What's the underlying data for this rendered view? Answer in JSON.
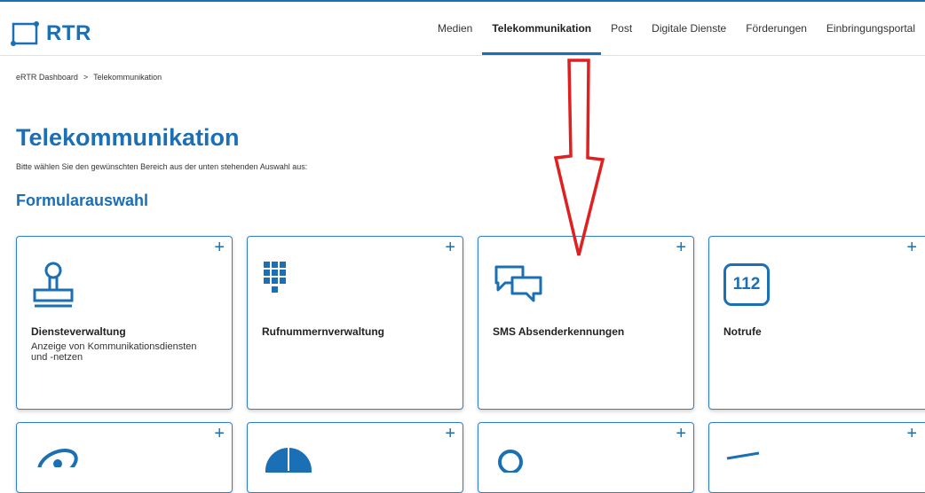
{
  "header": {
    "logo_text": "RTR",
    "nav": [
      "Medien",
      "Telekommunikation",
      "Post",
      "Digitale Dienste",
      "Förderungen",
      "Einbringungsportal"
    ],
    "active_nav": "Telekommunikation"
  },
  "breadcrumb": {
    "items": [
      "eRTR Dashboard",
      "Telekommunikation"
    ],
    "separator": ">"
  },
  "main": {
    "title": "Telekommunikation",
    "intro": "Bitte wählen Sie den gewünschten Bereich aus der unten stehenden Auswahl aus:",
    "section_title": "Formularauswahl",
    "plus_symbol": "+",
    "tiles": [
      {
        "title": "Diensteverwaltung",
        "description": "Anzeige von Kommunikationsdiensten und -netzen",
        "icon": "stamp-icon"
      },
      {
        "title": "Rufnummernverwaltung",
        "description": "",
        "icon": "keypad-icon"
      },
      {
        "title": "SMS Absenderkennungen",
        "description": "",
        "icon": "chat-bubbles-icon"
      },
      {
        "title": "Notrufe",
        "description": "",
        "icon": "emergency-112-icon",
        "icon_text": "112"
      },
      {
        "title": "",
        "description": "",
        "icon": "satellite-icon"
      },
      {
        "title": "",
        "description": "",
        "icon": "pie-chart-icon"
      },
      {
        "title": "",
        "description": "",
        "icon": "person-icon"
      },
      {
        "title": "",
        "description": "",
        "icon": "send-icon"
      }
    ]
  },
  "annotation": {
    "type": "red-arrow",
    "color": "#e02020"
  },
  "colors": {
    "brand": "#1a6fb5",
    "tile_border": "#2f7fc6",
    "annotation": "#e02020"
  }
}
